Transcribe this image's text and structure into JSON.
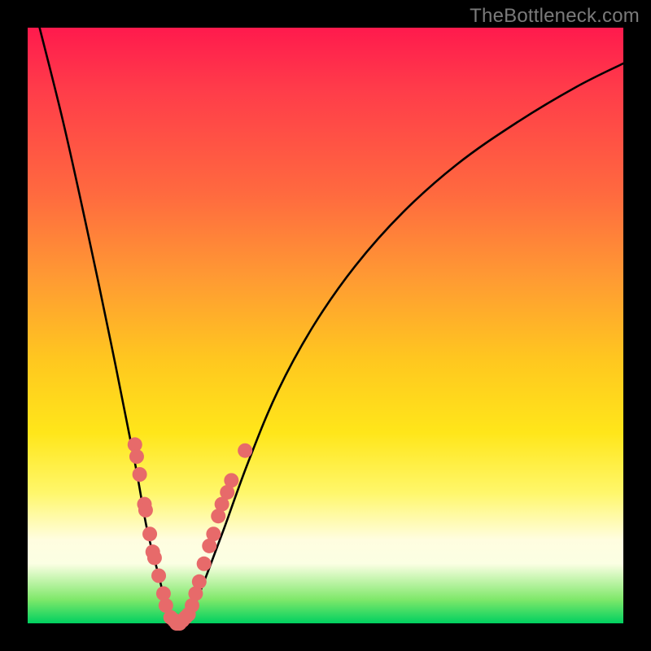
{
  "watermark": {
    "text": "TheBottleneck.com"
  },
  "colors": {
    "curve_stroke": "#000000",
    "point_fill": "#e76a6a",
    "point_stroke": "#c94444"
  },
  "chart_data": {
    "type": "line",
    "title": "",
    "xlabel": "",
    "ylabel": "",
    "xlim": [
      0,
      100
    ],
    "ylim": [
      0,
      100
    ],
    "series": [
      {
        "name": "bottleneck-curve",
        "x": [
          2,
          6,
          10,
          14,
          18,
          20,
          22,
          23,
          24,
          25,
          26,
          27,
          28,
          30,
          33,
          37,
          42,
          48,
          55,
          63,
          72,
          82,
          92,
          100
        ],
        "y": [
          100,
          84,
          66,
          47,
          27,
          16,
          8,
          4,
          1,
          0,
          0,
          1,
          3,
          8,
          16,
          27,
          39,
          50,
          60,
          69,
          77,
          84,
          90,
          94
        ]
      }
    ],
    "points": [
      {
        "name": "left-cluster",
        "coords": [
          {
            "x": 18.0,
            "y": 30
          },
          {
            "x": 18.3,
            "y": 28
          },
          {
            "x": 18.8,
            "y": 25
          },
          {
            "x": 19.6,
            "y": 20
          },
          {
            "x": 19.8,
            "y": 19
          },
          {
            "x": 20.5,
            "y": 15
          },
          {
            "x": 21.0,
            "y": 12
          },
          {
            "x": 21.3,
            "y": 11
          },
          {
            "x": 22.0,
            "y": 8
          },
          {
            "x": 22.8,
            "y": 5
          },
          {
            "x": 23.2,
            "y": 3
          },
          {
            "x": 24.0,
            "y": 1
          },
          {
            "x": 24.6,
            "y": 0.5
          },
          {
            "x": 25.0,
            "y": 0
          },
          {
            "x": 25.5,
            "y": 0
          },
          {
            "x": 26.0,
            "y": 0.5
          },
          {
            "x": 26.5,
            "y": 1
          },
          {
            "x": 27.0,
            "y": 1.5
          }
        ]
      },
      {
        "name": "right-cluster",
        "coords": [
          {
            "x": 27.6,
            "y": 3
          },
          {
            "x": 28.2,
            "y": 5
          },
          {
            "x": 28.8,
            "y": 7
          },
          {
            "x": 29.6,
            "y": 10
          },
          {
            "x": 30.5,
            "y": 13
          },
          {
            "x": 31.2,
            "y": 15
          },
          {
            "x": 32.0,
            "y": 18
          },
          {
            "x": 32.6,
            "y": 20
          },
          {
            "x": 33.5,
            "y": 22
          },
          {
            "x": 34.2,
            "y": 24
          },
          {
            "x": 36.5,
            "y": 29
          }
        ]
      }
    ]
  }
}
